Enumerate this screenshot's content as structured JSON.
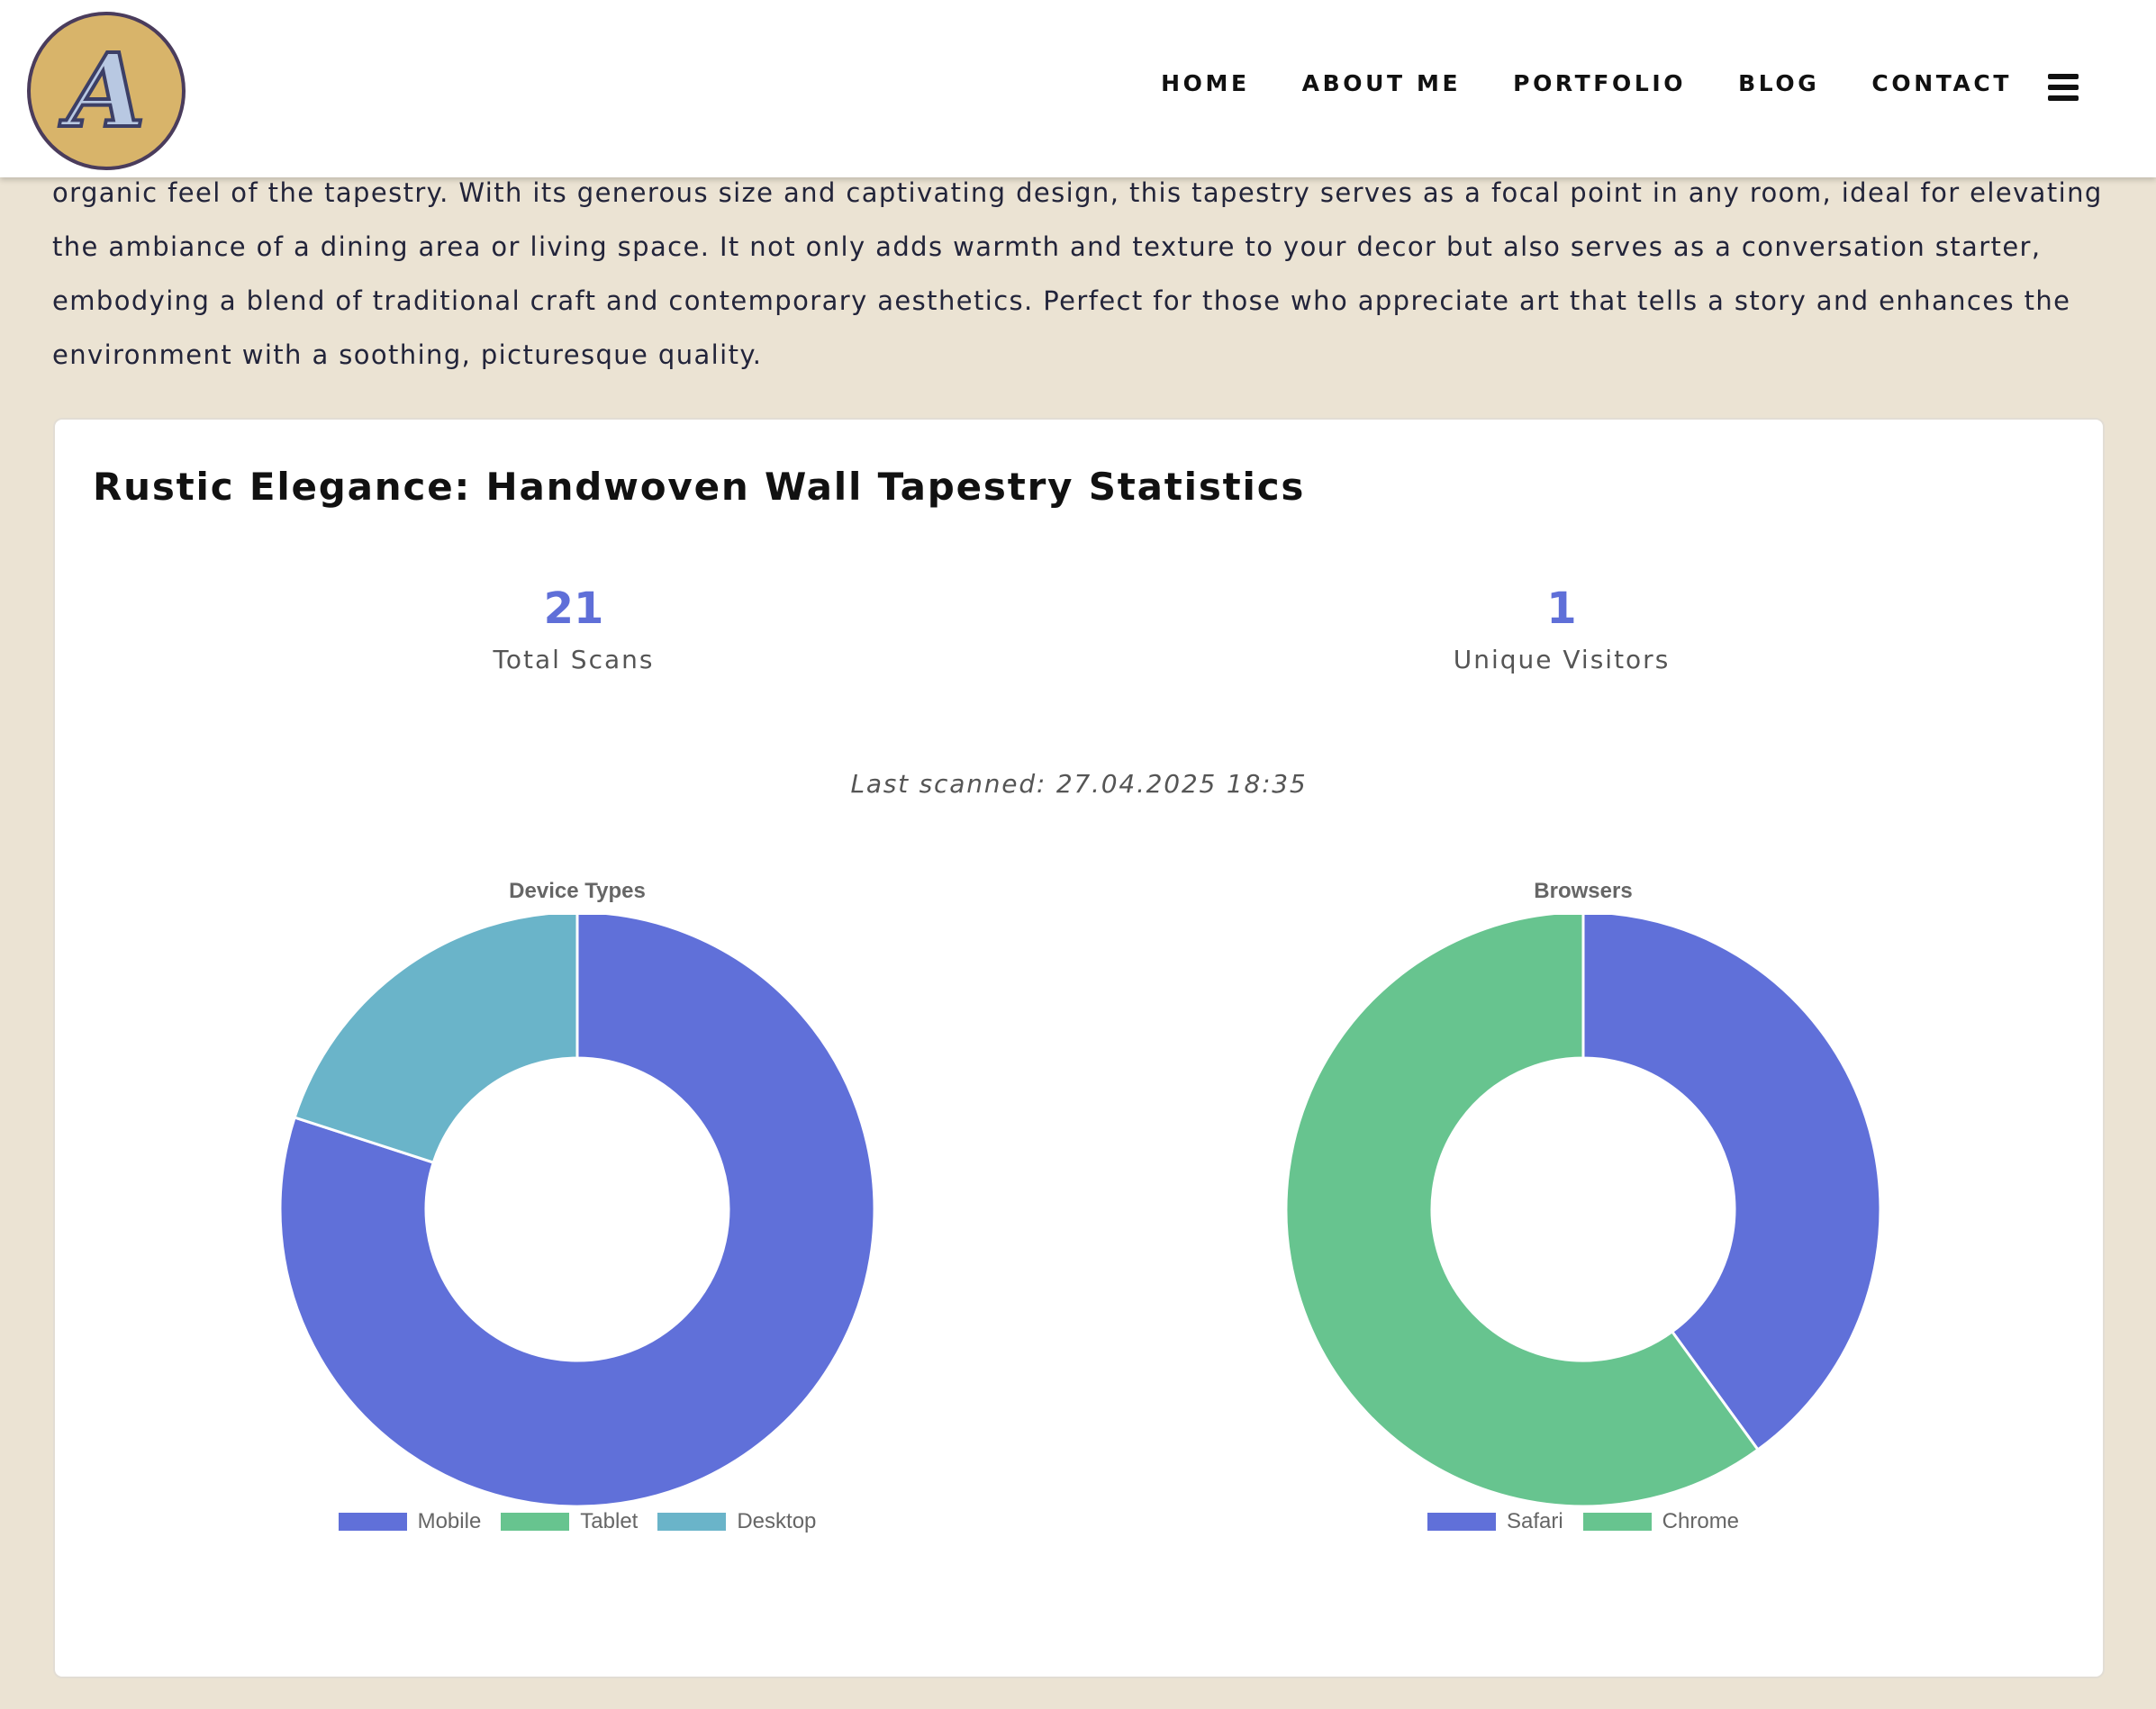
{
  "header": {
    "logo_letter": "A",
    "nav": [
      "HOME",
      "ABOUT ME",
      "PORTFOLIO",
      "BLOG",
      "CONTACT"
    ]
  },
  "intro": {
    "text": "organic feel of the tapestry. With its generous size and captivating design, this tapestry serves as a focal point in any room, ideal for elevating the ambiance of a dining area or living space. It not only adds warmth and texture to your decor but also serves as a conversation starter, embodying a blend of traditional craft and contemporary aesthetics. Perfect for those who appreciate art that tells a story and enhances the environment with a soothing, picturesque quality."
  },
  "stats": {
    "title": "Rustic Elegance: Handwoven Wall Tapestry Statistics",
    "total_scans": {
      "value": "21",
      "label": "Total Scans"
    },
    "unique_visitors": {
      "value": "1",
      "label": "Unique Visitors"
    },
    "last_scanned": "Last scanned: 27.04.2025 18:35"
  },
  "colors": {
    "mobile": "#6070d9",
    "tablet": "#67c48f",
    "desktop": "#6ab4c9",
    "safari": "#6070d9",
    "chrome": "#67c48f"
  },
  "chart_data": [
    {
      "type": "doughnut",
      "title": "Device Types",
      "labels": [
        "Mobile",
        "Tablet",
        "Desktop"
      ],
      "values": [
        80,
        0,
        20
      ],
      "colors": [
        "#6070d9",
        "#67c48f",
        "#6ab4c9"
      ],
      "legend": "bottom"
    },
    {
      "type": "doughnut",
      "title": "Browsers",
      "labels": [
        "Safari",
        "Chrome"
      ],
      "values": [
        40,
        60
      ],
      "colors": [
        "#6070d9",
        "#67c48f"
      ],
      "legend": "bottom"
    }
  ]
}
